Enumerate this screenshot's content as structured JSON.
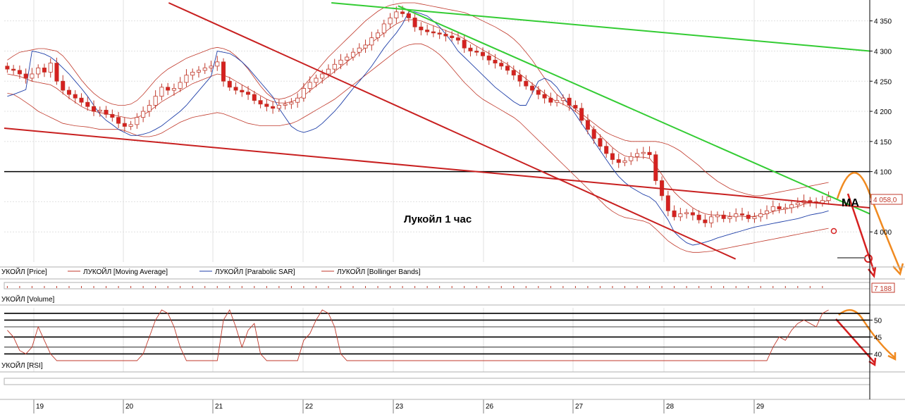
{
  "annotation": "Лукойл   1 час",
  "ma_label": "MA",
  "last_price_label": "4 058,0",
  "volume_label": "7 188",
  "legend": [
    {
      "text": "УКОЙЛ [Price]",
      "color": "#000000"
    },
    {
      "text": "ЛУКОЙЛ [Moving Average]",
      "color": "#c0392b"
    },
    {
      "text": "ЛУКОЙЛ [Parabolic SAR]",
      "color": "#1f3fa8"
    },
    {
      "text": "ЛУКОЙЛ [Bollinger Bands]",
      "color": "#c0392b"
    }
  ],
  "volume_panel_title": "УКОЙЛ [Volume]",
  "rsi_panel_title": "УКОЙЛ [RSI]",
  "colors": {
    "bull": "#ffffff",
    "bear": "#d62020",
    "candle_border": "#c0392b",
    "sar": "#1f3fa8",
    "band": "#c0392b",
    "trend_green": "#33cc33",
    "trend_red": "#c82020",
    "forecast_orange": "#f08a20",
    "grid": "#e0e0e0"
  },
  "chart_data": [
    {
      "type": "candlestick",
      "title": "Лукойл   1 час",
      "x_labels": [
        "19",
        "20",
        "21",
        "22",
        "23",
        "26",
        "27",
        "28",
        "29"
      ],
      "ylim": [
        3950,
        4380
      ],
      "y_ticks": [
        4000,
        4050,
        4100,
        4150,
        4200,
        4250,
        4300,
        4350
      ],
      "horizontal_level": 4100,
      "last_price": 4058,
      "grid": true,
      "close": [
        4270,
        4268,
        4262,
        4255,
        4262,
        4272,
        4265,
        4280,
        4250,
        4235,
        4228,
        4222,
        4215,
        4208,
        4200,
        4202,
        4195,
        4190,
        4180,
        4175,
        4178,
        4190,
        4200,
        4210,
        4225,
        4240,
        4235,
        4238,
        4248,
        4260,
        4265,
        4268,
        4272,
        4275,
        4282,
        4250,
        4240,
        4235,
        4232,
        4228,
        4218,
        4212,
        4208,
        4205,
        4210,
        4212,
        4215,
        4222,
        4238,
        4248,
        4255,
        4262,
        4270,
        4278,
        4285,
        4290,
        4298,
        4305,
        4310,
        4322,
        4330,
        4345,
        4355,
        4365,
        4362,
        4355,
        4340,
        4335,
        4332,
        4330,
        4328,
        4325,
        4322,
        4318,
        4305,
        4300,
        4298,
        4292,
        4285,
        4280,
        4275,
        4268,
        4260,
        4250,
        4242,
        4235,
        4228,
        4222,
        4215,
        4218,
        4222,
        4210,
        4205,
        4185,
        4170,
        4155,
        4142,
        4130,
        4120,
        4115,
        4118,
        4125,
        4130,
        4132,
        4128,
        4085,
        4060,
        4035,
        4025,
        4030,
        4032,
        4028,
        4020,
        4015,
        4025,
        4028,
        4022,
        4025,
        4030,
        4028,
        4022,
        4025,
        4030,
        4035,
        4042,
        4038,
        4040,
        4045,
        4048,
        4052,
        4050,
        4048,
        4052,
        4058
      ],
      "series": [
        {
          "name": "ЛУКОЙЛ [Moving Average]",
          "values": [
            4262,
            4260,
            4258,
            4254,
            4250,
            4248,
            4246,
            4244,
            4238,
            4230,
            4222,
            4215,
            4208,
            4203,
            4200,
            4198,
            4196,
            4194,
            4192,
            4190,
            4188,
            4190,
            4194,
            4200,
            4208,
            4216,
            4222,
            4228,
            4234,
            4240,
            4246,
            4250,
            4254,
            4258,
            4262,
            4260,
            4256,
            4250,
            4244,
            4238,
            4232,
            4226,
            4220,
            4216,
            4214,
            4214,
            4216,
            4220,
            4226,
            4234,
            4242,
            4250,
            4258,
            4266,
            4274,
            4282,
            4290,
            4298,
            4306,
            4314,
            4322,
            4330,
            4338,
            4345,
            4350,
            4352,
            4352,
            4350,
            4346,
            4342,
            4338,
            4334,
            4330,
            4326,
            4320,
            4314,
            4308,
            4302,
            4296,
            4290,
            4284,
            4278,
            4270,
            4262,
            4254,
            4246,
            4238,
            4230,
            4222,
            4216,
            4212,
            4206,
            4200,
            4192,
            4182,
            4170,
            4160,
            4150,
            4140,
            4132,
            4126,
            4124,
            4124,
            4124,
            4122,
            4110,
            4095,
            4080,
            4066,
            4056,
            4048,
            4040,
            4034,
            4030,
            4028,
            4028,
            4027,
            4026,
            4026,
            4026,
            4025,
            4026,
            4028,
            4030,
            4034,
            4036,
            4038,
            4040,
            4042,
            4046,
            4048,
            4048,
            4050,
            4052
          ]
        },
        {
          "name": "ЛУКОЙЛ [Parabolic SAR]",
          "values": [
            4225,
            4228,
            4232,
            4236,
            4300,
            4298,
            4295,
            4290,
            4282,
            4272,
            4262,
            4250,
            4238,
            4225,
            4210,
            4195,
            4185,
            4178,
            4170,
            4165,
            4160,
            4160,
            4162,
            4165,
            4170,
            4176,
            4184,
            4192,
            4200,
            4210,
            4222,
            4234,
            4246,
            4258,
            4300,
            4298,
            4296,
            4290,
            4282,
            4272,
            4260,
            4248,
            4236,
            4224,
            4205,
            4190,
            4175,
            4168,
            4165,
            4168,
            4172,
            4180,
            4190,
            4200,
            4212,
            4225,
            4238,
            4250,
            4262,
            4275,
            4290,
            4305,
            4318,
            4330,
            4345,
            4365,
            4365,
            4362,
            4358,
            4350,
            4340,
            4328,
            4315,
            4300,
            4290,
            4280,
            4270,
            4260,
            4250,
            4240,
            4232,
            4224,
            4216,
            4210,
            4210,
            4230,
            4250,
            4255,
            4250,
            4240,
            4225,
            4210,
            4195,
            4180,
            4165,
            4150,
            4135,
            4120,
            4105,
            4092,
            4082,
            4074,
            4068,
            4062,
            4058,
            4050,
            4035,
            4020,
            4000,
            3990,
            3982,
            3978,
            3980,
            3983,
            3986,
            3990,
            3993,
            3996,
            3999,
            4002,
            4005,
            4008,
            4010,
            4012,
            4014,
            4016,
            4018,
            4020,
            4022,
            4025,
            4028,
            4030,
            4032,
            4035
          ]
        },
        {
          "name": "ЛУКОЙЛ [Bollinger Bands] upper",
          "values": [
            4285,
            4292,
            4298,
            4300,
            4302,
            4304,
            4304,
            4302,
            4300,
            4292,
            4280,
            4266,
            4252,
            4240,
            4230,
            4222,
            4216,
            4212,
            4210,
            4210,
            4212,
            4218,
            4228,
            4240,
            4252,
            4262,
            4270,
            4276,
            4282,
            4288,
            4292,
            4296,
            4300,
            4304,
            4306,
            4304,
            4300,
            4292,
            4282,
            4270,
            4256,
            4242,
            4230,
            4222,
            4220,
            4222,
            4226,
            4232,
            4242,
            4254,
            4266,
            4278,
            4290,
            4300,
            4310,
            4320,
            4330,
            4340,
            4350,
            4358,
            4366,
            4372,
            4376,
            4378,
            4380,
            4380,
            4380,
            4378,
            4376,
            4374,
            4372,
            4370,
            4368,
            4366,
            4364,
            4360,
            4355,
            4350,
            4345,
            4340,
            4334,
            4328,
            4320,
            4310,
            4298,
            4285,
            4270,
            4255,
            4240,
            4228,
            4220,
            4212,
            4204,
            4196,
            4188,
            4180,
            4172,
            4165,
            4160,
            4156,
            4152,
            4150,
            4150,
            4150,
            4150,
            4150,
            4148,
            4145,
            4140,
            4134,
            4126,
            4118,
            4110,
            4100,
            4092,
            4084,
            4078,
            4072,
            4068,
            4065,
            4062,
            4060,
            4060,
            4062,
            4064,
            4066,
            4068,
            4070,
            4072,
            4074,
            4076,
            4078,
            4080,
            4082
          ]
        },
        {
          "name": "ЛУКОЙЛ [Bollinger Bands] lower",
          "values": [
            4230,
            4228,
            4222,
            4215,
            4208,
            4200,
            4195,
            4190,
            4185,
            4180,
            4178,
            4176,
            4175,
            4174,
            4172,
            4170,
            4170,
            4170,
            4170,
            4168,
            4164,
            4160,
            4158,
            4158,
            4160,
            4164,
            4170,
            4176,
            4182,
            4186,
            4190,
            4192,
            4194,
            4196,
            4198,
            4196,
            4192,
            4188,
            4184,
            4180,
            4178,
            4176,
            4176,
            4176,
            4176,
            4178,
            4180,
            4184,
            4190,
            4196,
            4202,
            4208,
            4214,
            4220,
            4228,
            4236,
            4244,
            4252,
            4260,
            4268,
            4276,
            4284,
            4292,
            4300,
            4306,
            4310,
            4312,
            4312,
            4308,
            4302,
            4294,
            4284,
            4272,
            4260,
            4248,
            4238,
            4228,
            4220,
            4214,
            4208,
            4202,
            4196,
            4190,
            4182,
            4172,
            4162,
            4152,
            4142,
            4132,
            4122,
            4112,
            4102,
            4092,
            4082,
            4072,
            4062,
            4052,
            4042,
            4034,
            4028,
            4024,
            4022,
            4020,
            4018,
            4014,
            4005,
            3995,
            3985,
            3978,
            3972,
            3968,
            3966,
            3966,
            3967,
            3968,
            3970,
            3972,
            3974,
            3976,
            3978,
            3980,
            3982,
            3984,
            3986,
            3988,
            3990,
            3992,
            3994,
            3996,
            3998,
            4000,
            4002,
            4004,
            4006
          ]
        }
      ],
      "trendlines": [
        {
          "name": "resistance green 1",
          "color": "green",
          "from": [
            0.378,
            4380
          ],
          "to": [
            1.0,
            4300
          ]
        },
        {
          "name": "resistance green 2",
          "color": "green",
          "from": [
            0.455,
            4375
          ],
          "to": [
            1.0,
            4030
          ]
        },
        {
          "name": "channel red 1",
          "color": "red",
          "from": [
            0.19,
            4380
          ],
          "to": [
            0.845,
            3955
          ]
        },
        {
          "name": "channel red 2",
          "color": "red",
          "from": [
            0.0,
            4172
          ],
          "to": [
            1.0,
            4040
          ]
        }
      ]
    },
    {
      "type": "line",
      "title": "RSI",
      "ylim": [
        38,
        53
      ],
      "y_ticks": [
        40,
        45,
        50
      ],
      "values": [
        47,
        45,
        41,
        40,
        42,
        48,
        44,
        40,
        38,
        38,
        38,
        38,
        38,
        38,
        38,
        38,
        38,
        38,
        38,
        38,
        38,
        38,
        40,
        45,
        50,
        53,
        52,
        48,
        42,
        38,
        38,
        38,
        38,
        38,
        38,
        50,
        53,
        48,
        42,
        47,
        49,
        40,
        38,
        38,
        38,
        38,
        38,
        38,
        44,
        46,
        50,
        53,
        52,
        48,
        40,
        38,
        38,
        38,
        38,
        38,
        38,
        38,
        38,
        38,
        38,
        38,
        38,
        38,
        38,
        38,
        38,
        38,
        38,
        38,
        38,
        38,
        38,
        38,
        38,
        38,
        38,
        38,
        38,
        38,
        38,
        38,
        38,
        38,
        38,
        38,
        38,
        38,
        38,
        38,
        38,
        38,
        38,
        38,
        38,
        38,
        38,
        38,
        38,
        38,
        38,
        38,
        38,
        38,
        38,
        38,
        38,
        38,
        38,
        38,
        38,
        38,
        38,
        38,
        38,
        38,
        38,
        38,
        38,
        38,
        42,
        45,
        44,
        47,
        49,
        50,
        49,
        48,
        52,
        53
      ]
    }
  ]
}
